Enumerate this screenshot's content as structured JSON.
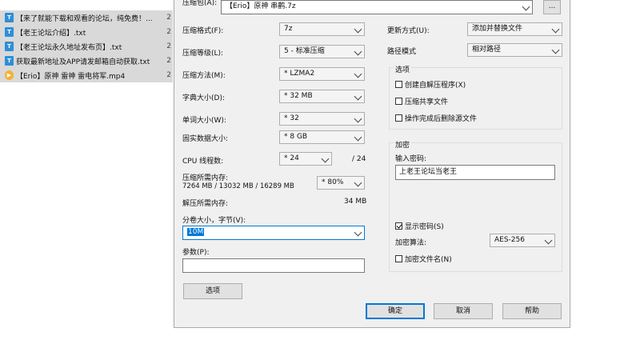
{
  "files": [
    {
      "name": "【来了就能下载和观看的论坛，纯免费！...",
      "size": "2",
      "type": "txt"
    },
    {
      "name": "【老王论坛介绍】.txt",
      "size": "2",
      "type": "txt"
    },
    {
      "name": "【老王论坛永久地址发布页】.txt",
      "size": "2",
      "type": "txt"
    },
    {
      "name": "获取最新地址及APP请发邮箱自动获取.txt",
      "size": "2",
      "type": "txt"
    },
    {
      "name": "【Erio】原神 雷神 雷电将军.mp4",
      "size": "2",
      "type": "mp4"
    }
  ],
  "archive": {
    "label": "压缩包(A):",
    "value": "【Erio】原神 串鹳.7z",
    "browse": "..."
  },
  "left": {
    "format_label": "压缩格式(F):",
    "format_value": "7z",
    "level_label": "压缩等级(L):",
    "level_value": "5 - 标准压缩",
    "method_label": "压缩方法(M):",
    "method_value": "* LZMA2",
    "dict_label": "字典大小(D):",
    "dict_value": "* 32 MB",
    "word_label": "单词大小(W):",
    "word_value": "* 32",
    "solid_label": "固实数据大小:",
    "solid_value": "* 8 GB",
    "threads_label": "CPU 线程数:",
    "threads_value": "* 24",
    "threads_max": "/ 24",
    "mem_label": "压缩所需内存:",
    "mem_detail": "7264 MB / 13032 MB / 16289 MB",
    "mem_value": "* 80%",
    "decomp_label": "解压所需内存:",
    "decomp_value": "34 MB",
    "volume_label": "分卷大小，字节(V):",
    "volume_value": "10M",
    "params_label": "参数(P):",
    "params_value": "",
    "options_button": "选项"
  },
  "right": {
    "update_label": "更新方式(U):",
    "update_value": "添加并替换文件",
    "path_label": "路径模式",
    "path_value": "相对路径",
    "options_group": "选项",
    "opt_sfx": "创建自解压程序(X)",
    "opt_shared": "压缩共享文件",
    "opt_delete": "操作完成后删除源文件",
    "enc_group": "加密",
    "password_label": "输入密码:",
    "password_value": "上老王论坛当老王",
    "show_password": "显示密码(S)",
    "enc_method_label": "加密算法:",
    "enc_method_value": "AES-256",
    "encrypt_names": "加密文件名(N)"
  },
  "buttons": {
    "ok": "确定",
    "cancel": "取消",
    "help": "帮助"
  },
  "colors": {
    "selection": "#0078d7",
    "file_row_bg": "#d9d9d9",
    "dialog_bg": "#f0f0f0"
  }
}
